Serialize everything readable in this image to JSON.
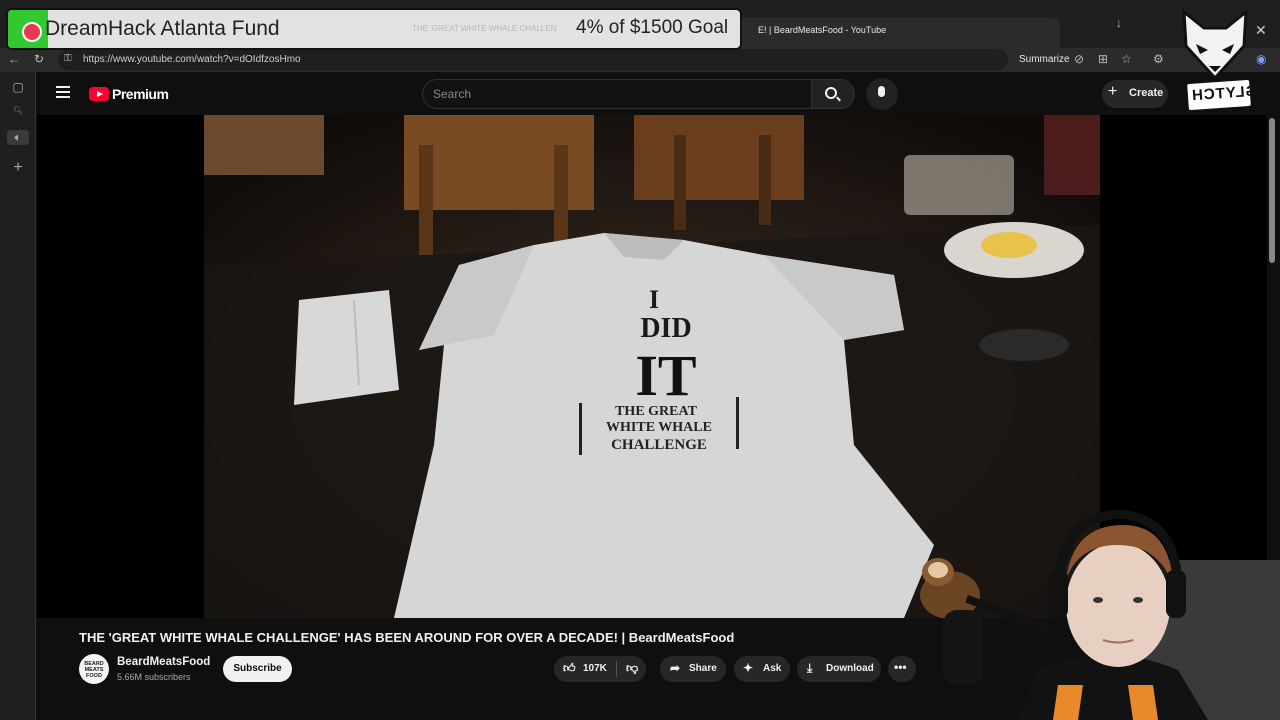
{
  "browser": {
    "tab_title": "E! | BeardMeatsFood - YouTube",
    "url": "https://www.youtube.com/watch?v=dOIdfzosHmo",
    "summarize_label": "Summarize",
    "close_glyph": "✕"
  },
  "youtube": {
    "logo_text": "Premium",
    "search_placeholder": "Search",
    "create_label": "Create",
    "video_title": "THE 'GREAT WHITE WHALE CHALLENGE' HAS BEEN AROUND FOR OVER A DECADE! | BeardMeatsFood",
    "channel": {
      "name": "BeardMeatsFood",
      "subscribers": "5.66M subscribers",
      "avatar_text": "BEARD MEATS FOOD"
    },
    "subscribe_label": "Subscribe",
    "actions": {
      "like_count": "107K",
      "share_label": "Share",
      "ask_label": "Ask",
      "download_label": "Download"
    },
    "video_shirt_text": [
      "I",
      "DID",
      "IT",
      "THE GREAT",
      "WHITE WHALE",
      "CHALLENGE"
    ]
  },
  "overlay": {
    "fund_title": "DreamHack Atlanta Fund",
    "fund_ghost_text": "THE 'GREAT WHITE WHALE CHALLEN",
    "fund_goal": "4% of $1500 Goal",
    "fund_progress_percent": 4,
    "glytch_text": "GLYTCH"
  },
  "colors": {
    "youtube_red": "#ff0033",
    "progress_green": "#32c832",
    "page_bg": "#0f0f0f"
  }
}
